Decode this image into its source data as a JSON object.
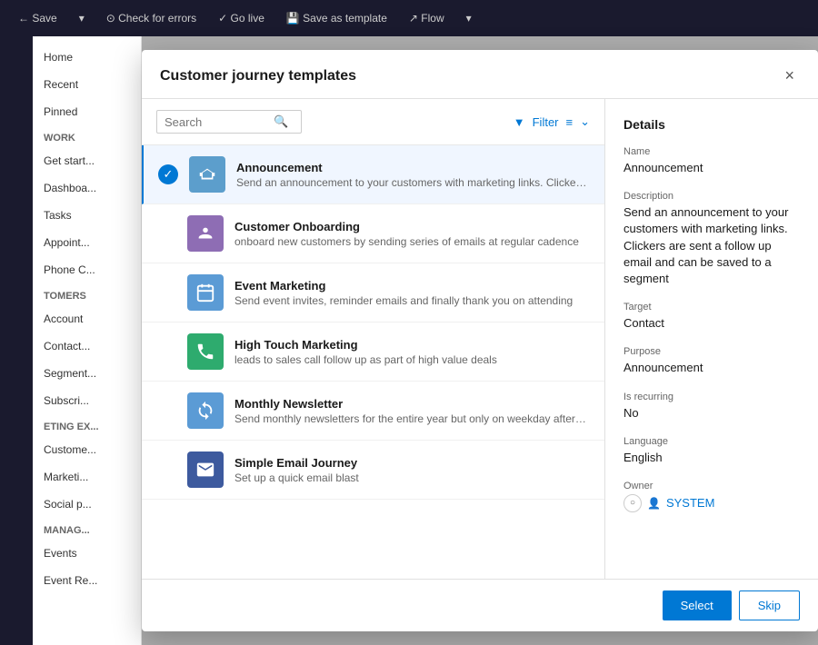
{
  "app": {
    "header": {
      "buttons": [
        {
          "label": "← Save",
          "name": "save-btn"
        },
        {
          "label": "↓",
          "name": "save-dropdown-btn"
        },
        {
          "label": "⊙ Check for errors",
          "name": "check-errors-btn"
        },
        {
          "label": "✓ Go live",
          "name": "go-live-btn"
        },
        {
          "label": "💾 Save as template",
          "name": "save-template-btn"
        },
        {
          "label": "↗ Flow",
          "name": "flow-btn"
        },
        {
          "label": "↓",
          "name": "flow-dropdown-btn"
        }
      ]
    },
    "nav": {
      "items": [
        {
          "label": "Home",
          "name": "nav-home"
        },
        {
          "label": "Recent",
          "name": "nav-recent"
        },
        {
          "label": "Pinned",
          "name": "nav-pinned"
        },
        {
          "label": "Work",
          "name": "nav-work-section",
          "type": "section"
        },
        {
          "label": "Get start...",
          "name": "nav-get-started"
        },
        {
          "label": "Dashboa...",
          "name": "nav-dashboard"
        },
        {
          "label": "Tasks",
          "name": "nav-tasks"
        },
        {
          "label": "Appoint...",
          "name": "nav-appointments"
        },
        {
          "label": "Phone C...",
          "name": "nav-phone-calls"
        },
        {
          "label": "tomers",
          "name": "nav-customers-section",
          "type": "section"
        },
        {
          "label": "Account",
          "name": "nav-account"
        },
        {
          "label": "Contact...",
          "name": "nav-contacts"
        },
        {
          "label": "Segment...",
          "name": "nav-segments"
        },
        {
          "label": "Subscri...",
          "name": "nav-subscriptions"
        },
        {
          "label": "eting ex...",
          "name": "nav-marketing-section",
          "type": "section"
        },
        {
          "label": "Custome...",
          "name": "nav-customer-journeys"
        },
        {
          "label": "Marketi...",
          "name": "nav-marketing-emails"
        },
        {
          "label": "Social p...",
          "name": "nav-social-posts"
        },
        {
          "label": "manag...",
          "name": "nav-manage-section",
          "type": "section"
        },
        {
          "label": "Events",
          "name": "nav-events"
        },
        {
          "label": "Event Re...",
          "name": "nav-event-registrations"
        }
      ]
    }
  },
  "modal": {
    "title": "Customer journey templates",
    "close_label": "×",
    "search": {
      "placeholder": "Search",
      "filter_label": "Filter"
    },
    "templates": [
      {
        "id": "announcement",
        "name": "Announcement",
        "description": "Send an announcement to your customers with marketing links. Clickers are sent a...",
        "icon_color": "#5c9ecc",
        "icon_symbol": "📢",
        "selected": true
      },
      {
        "id": "customer-onboarding",
        "name": "Customer Onboarding",
        "description": "onboard new customers by sending series of emails at regular cadence",
        "icon_color": "#8e6db4",
        "icon_symbol": "👤",
        "selected": false
      },
      {
        "id": "event-marketing",
        "name": "Event Marketing",
        "description": "Send event invites, reminder emails and finally thank you on attending",
        "icon_color": "#5b9bd5",
        "icon_symbol": "📅",
        "selected": false
      },
      {
        "id": "high-touch-marketing",
        "name": "High Touch Marketing",
        "description": "leads to sales call follow up as part of high value deals",
        "icon_color": "#2eab6e",
        "icon_symbol": "📞",
        "selected": false
      },
      {
        "id": "monthly-newsletter",
        "name": "Monthly Newsletter",
        "description": "Send monthly newsletters for the entire year but only on weekday afternoons",
        "icon_color": "#5b9bd5",
        "icon_symbol": "🔄",
        "selected": false
      },
      {
        "id": "simple-email-journey",
        "name": "Simple Email Journey",
        "description": "Set up a quick email blast",
        "icon_color": "#3d5a9e",
        "icon_symbol": "✉",
        "selected": false
      }
    ],
    "details": {
      "section_title": "Details",
      "name_label": "Name",
      "name_value": "Announcement",
      "description_label": "Description",
      "description_value": "Send an announcement to your customers with marketing links. Clickers are sent a follow up email and can be saved to a segment",
      "target_label": "Target",
      "target_value": "Contact",
      "purpose_label": "Purpose",
      "purpose_value": "Announcement",
      "recurring_label": "Is recurring",
      "recurring_value": "No",
      "language_label": "Language",
      "language_value": "English",
      "owner_label": "Owner",
      "owner_value": "SYSTEM"
    },
    "footer": {
      "select_label": "Select",
      "skip_label": "Skip"
    }
  }
}
